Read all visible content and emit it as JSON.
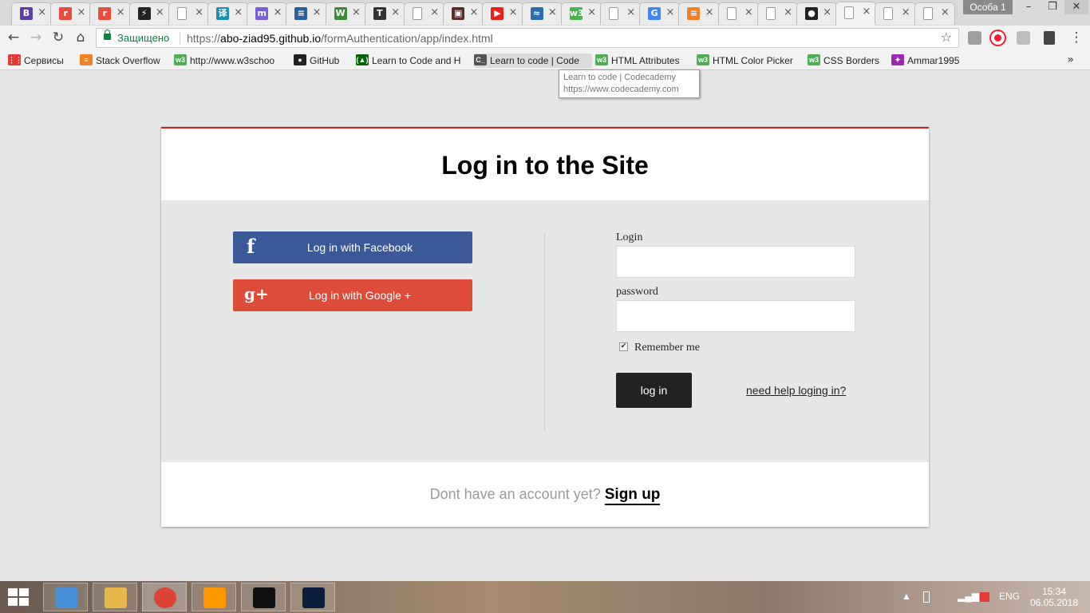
{
  "browser": {
    "tabs": [
      {
        "icon": "vk-icon",
        "glyph": "B",
        "color": "#5b3fa0"
      },
      {
        "icon": "r-circle-icon",
        "glyph": "r",
        "color": "#e74c3c"
      },
      {
        "icon": "r-circle-icon",
        "glyph": "r",
        "color": "#e74c3c"
      },
      {
        "icon": "bolt-icon",
        "glyph": "⚡",
        "color": "#222222"
      },
      {
        "icon": "page-icon",
        "glyph": "",
        "color": "#999999"
      },
      {
        "icon": "translate-icon",
        "glyph": "译",
        "color": "#1b8db3"
      },
      {
        "icon": "messenger-icon",
        "glyph": "m",
        "color": "#7b5fd6"
      },
      {
        "icon": "stack-icon",
        "glyph": "≡",
        "color": "#2d5f9a"
      },
      {
        "icon": "w-icon",
        "glyph": "W",
        "color": "#3d8a3d"
      },
      {
        "icon": "t-icon",
        "glyph": "T",
        "color": "#333333"
      },
      {
        "icon": "page-icon",
        "glyph": "",
        "color": "#999999"
      },
      {
        "icon": "image-icon",
        "glyph": "▣",
        "color": "#5a2a2a"
      },
      {
        "icon": "youtube-icon",
        "glyph": "▶",
        "color": "#e62117"
      },
      {
        "icon": "wave-icon",
        "glyph": "≈",
        "color": "#2b6cb0"
      },
      {
        "icon": "w3schools-icon",
        "glyph": "w3",
        "color": "#4caf50"
      },
      {
        "icon": "page-icon",
        "glyph": "",
        "color": "#999999"
      },
      {
        "icon": "google-icon",
        "glyph": "G",
        "color": "#4285f4"
      },
      {
        "icon": "stackoverflow-icon",
        "glyph": "≡",
        "color": "#f48024"
      },
      {
        "icon": "page-icon",
        "glyph": "",
        "color": "#999999"
      },
      {
        "icon": "page-icon",
        "glyph": "",
        "color": "#999999"
      },
      {
        "icon": "github-icon",
        "glyph": "●",
        "color": "#222222"
      },
      {
        "icon": "page-icon",
        "glyph": "",
        "color": "#999999",
        "active": true
      },
      {
        "icon": "page-icon",
        "glyph": "",
        "color": "#999999"
      },
      {
        "icon": "page-icon",
        "glyph": "",
        "color": "#999999"
      }
    ],
    "tab_close": "×",
    "profile": "Особа 1",
    "window": {
      "minimize": "–",
      "restore": "❐",
      "close": "✕"
    },
    "nav": {
      "back": "←",
      "forward": "→",
      "reload": "↻",
      "home": "⌂"
    },
    "secure_label": "Защищено",
    "url_scheme": "https://",
    "url_host": "abo-ziad95.github.io",
    "url_path": "/formAuthentication/app/index.html",
    "bookmark_star": "☆",
    "bookmarks": [
      {
        "label": "Сервисы",
        "icon": "apps-grid-icon",
        "color": "#e53935",
        "glyph": "⋮⋮"
      },
      {
        "label": "Stack Overflow",
        "icon": "stackoverflow-icon",
        "color": "#f48024",
        "glyph": "≡"
      },
      {
        "label": "http://www.w3schoo",
        "icon": "w3schools-icon",
        "color": "#4caf50",
        "glyph": "w3"
      },
      {
        "label": "GitHub",
        "icon": "github-icon",
        "color": "#222222",
        "glyph": "●"
      },
      {
        "label": "Learn to Code and H",
        "icon": "freecodecamp-icon",
        "color": "#006400",
        "glyph": "(▲)"
      },
      {
        "label": "Learn to code | Code",
        "icon": "codecademy-icon",
        "color": "#555555",
        "glyph": "C_"
      },
      {
        "label": "HTML Attributes",
        "icon": "w3schools-icon",
        "color": "#4caf50",
        "glyph": "w3"
      },
      {
        "label": "HTML Color Picker",
        "icon": "w3schools-icon",
        "color": "#4caf50",
        "glyph": "w3"
      },
      {
        "label": "CSS Borders",
        "icon": "w3schools-icon",
        "color": "#4caf50",
        "glyph": "w3"
      },
      {
        "label": "Ammar1995",
        "icon": "colorful-star-icon",
        "color": "#9c27b0",
        "glyph": "✦"
      }
    ],
    "bookmarks_more": "»",
    "tooltip_title": "Learn to code | Codecademy",
    "tooltip_url": "https://www.codecademy.com"
  },
  "page": {
    "title": "Log in to the Site",
    "facebook_label": "Log in with Facebook",
    "facebook_glyph": "f",
    "google_label": "Log in with Google +",
    "google_glyph": "g+",
    "login_label": "Login",
    "login_value": "",
    "password_label": "password",
    "password_value": "",
    "remember_label": "Remember me",
    "remember_checked": true,
    "remember_mark": "✔",
    "login_button": "log in",
    "help_link": "need help loging in?",
    "footer_text": "Dont have an account yet?",
    "signup_link": "Sign up",
    "colors": {
      "accent": "#d91b1b",
      "facebook": "#3b5998",
      "google": "#dd4b39",
      "button": "#222222"
    }
  },
  "taskbar": {
    "apps": [
      {
        "icon": "control-panel-icon",
        "color": "#4a90d9"
      },
      {
        "icon": "file-explorer-icon",
        "color": "#e8b84a"
      },
      {
        "icon": "chrome-icon",
        "color": "#db4437"
      },
      {
        "icon": "sublime-text-icon",
        "color": "#ff9800"
      },
      {
        "icon": "terminal-icon",
        "color": "#111111"
      },
      {
        "icon": "photoshop-icon",
        "color": "#0a1e3c"
      }
    ],
    "language": "ENG",
    "time": "15:34",
    "date": "06.05.2018"
  }
}
